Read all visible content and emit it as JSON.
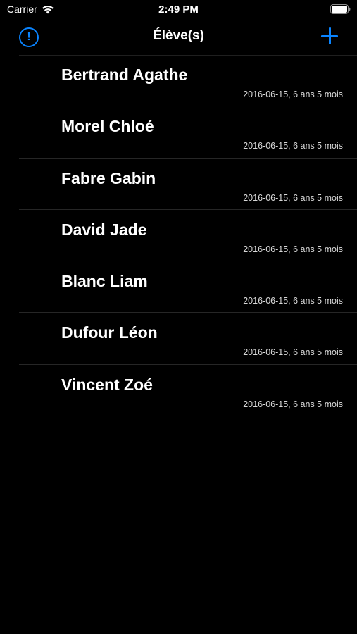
{
  "status_bar": {
    "carrier": "Carrier",
    "time": "2:49 PM",
    "wifi_icon": "wifi-icon",
    "battery_icon": "battery-icon"
  },
  "nav": {
    "title": "Élève(s)",
    "info_icon": "exclamation-circle-icon",
    "info_symbol": "!",
    "add_icon": "plus-icon"
  },
  "colors": {
    "accent": "#0a84ff",
    "background": "#000000",
    "text": "#ffffff",
    "separator": "#262626"
  },
  "students": [
    {
      "name": "Bertrand Agathe",
      "detail": "2016-06-15, 6 ans 5 mois"
    },
    {
      "name": "Morel Chloé",
      "detail": "2016-06-15, 6 ans 5 mois"
    },
    {
      "name": "Fabre Gabin",
      "detail": "2016-06-15, 6 ans 5 mois"
    },
    {
      "name": "David Jade",
      "detail": "2016-06-15, 6 ans 5 mois"
    },
    {
      "name": "Blanc Liam",
      "detail": "2016-06-15, 6 ans 5 mois"
    },
    {
      "name": "Dufour Léon",
      "detail": "2016-06-15, 6 ans 5 mois"
    },
    {
      "name": "Vincent Zoé",
      "detail": "2016-06-15, 6 ans 5 mois"
    }
  ]
}
